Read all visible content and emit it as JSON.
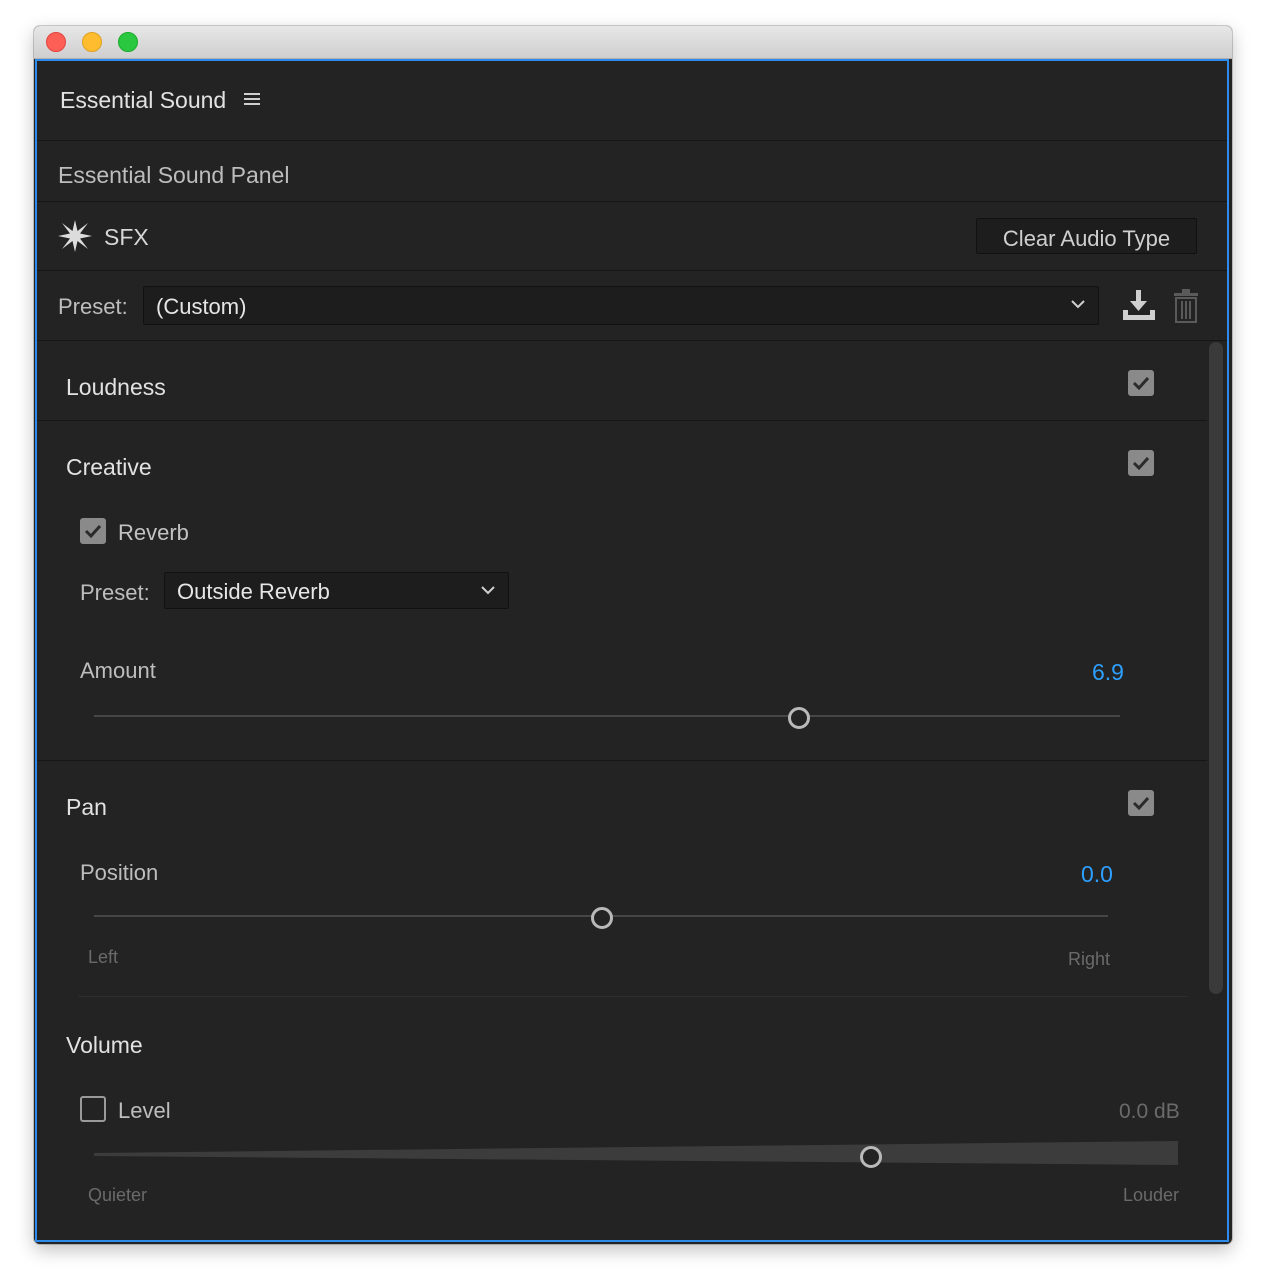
{
  "panel": {
    "title": "Essential Sound",
    "subtitle": "Essential Sound Panel",
    "audio_type": "SFX",
    "clear_button": "Clear Audio Type",
    "preset_label": "Preset:",
    "preset_value": "(Custom)"
  },
  "loudness": {
    "label": "Loudness",
    "enabled": true
  },
  "creative": {
    "label": "Creative",
    "enabled": true,
    "reverb": {
      "label": "Reverb",
      "checked": true,
      "preset_label": "Preset:",
      "preset_value": "Outside Reverb",
      "amount_label": "Amount",
      "amount_value": "6.9"
    }
  },
  "pan": {
    "label": "Pan",
    "enabled": true,
    "position_label": "Position",
    "position_value": "0.0",
    "left_label": "Left",
    "right_label": "Right"
  },
  "volume": {
    "label": "Volume",
    "level_label": "Level",
    "level_checked": false,
    "level_value": "0.0 dB",
    "quieter_label": "Quieter",
    "louder_label": "Louder"
  },
  "colors": {
    "accent": "#2d9fff",
    "border": "#2d8ceb",
    "bg": "#232323"
  },
  "icons": [
    "hamburger-menu-icon",
    "sfx-burst-icon",
    "chevron-down-icon",
    "save-preset-icon",
    "trash-icon",
    "checkmark-icon"
  ]
}
